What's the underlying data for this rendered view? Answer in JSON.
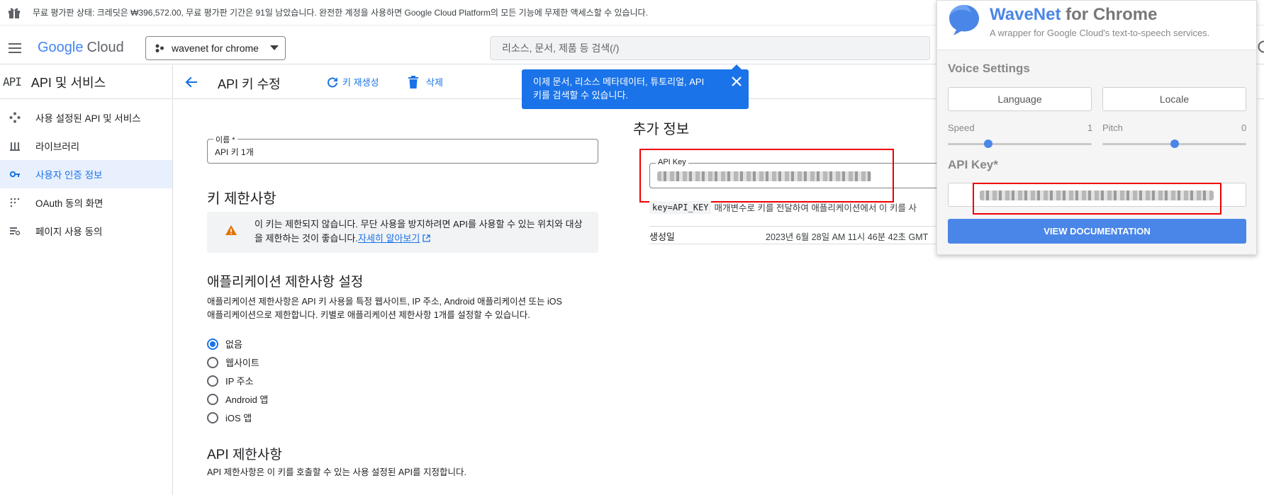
{
  "banner": {
    "text": "무료 평가판 상태: 크레딧은 ₩396,572.00, 무료 평가판 기간은 91일 남았습니다. 완전한 계정을 사용하면 Google Cloud Platform의 모든 기능에 무제한 액세스할 수 있습니다."
  },
  "topbar": {
    "logo_google": "Google",
    "logo_cloud": "Cloud",
    "project": "wavenet for chrome",
    "search_placeholder": "리소스, 문서, 제품 등 검색(/)"
  },
  "nav": {
    "api_badge": "API",
    "title": "API 및 서비스",
    "items": [
      {
        "label": "사용 설정된 API 및 서비스",
        "icon": "diamond-dots-icon"
      },
      {
        "label": "라이브러리",
        "icon": "library-icon"
      },
      {
        "label": "사용자 인증 정보",
        "icon": "key-icon"
      },
      {
        "label": "OAuth 동의 화면",
        "icon": "dots-grid-icon"
      },
      {
        "label": "페이지 사용 동의",
        "icon": "settings-list-icon"
      }
    ],
    "active_index": 2
  },
  "subbar": {
    "title": "API 키 수정",
    "regenerate": "키 재생성",
    "delete": "삭제"
  },
  "tooltip": {
    "text": "이제 문서, 리소스 메타데이터, 튜토리얼, API 키를 검색할 수 있습니다."
  },
  "form": {
    "name_label": "이름 *",
    "name_value": "API 키 1개",
    "key_restrictions_title": "키 제한사항",
    "warning_text": "이 키는 제한되지 않습니다. 무단 사용을 방지하려면 API를 사용할 수 있는 위치와 대상을 제한하는 것이 좋습니다.",
    "learn_more": "자세히 알아보기",
    "app_restrictions_title": "애플리케이션 제한사항 설정",
    "app_restrictions_desc_1": "애플리케이션 제한사항은 API 키 사용을 특정 웹사이트, IP 주소, Android 애플리케이션 또는 iOS",
    "app_restrictions_desc_2": "애플리케이션으로 제한합니다. 키별로 애플리케이션 제한사항 1개를 설정할 수 있습니다.",
    "radio_options": [
      "없음",
      "웹사이트",
      "IP 주소",
      "Android 앱",
      "iOS 앱"
    ],
    "selected_radio": 0,
    "api_restrictions_title": "API 제한사항",
    "api_restrictions_desc": "API 제한사항은 이 키를 호출할 수 있는 사용 설정된 API를 지정합니다."
  },
  "extra": {
    "title": "추가 정보",
    "api_key_label": "API Key",
    "param_code": "key=API_KEY",
    "param_desc": "매개변수로 키를 전달하여 애플리케이션에서 이 키를 사",
    "created_label": "생성일",
    "created_value": "2023년 6월 28일 AM 11시 46분 42초 GMT"
  },
  "extension": {
    "title_brand": "WaveNet",
    "title_rest": " for Chrome",
    "subtitle": "A wrapper for Google Cloud's text-to-speech services.",
    "voice_settings": "Voice Settings",
    "language_button": "Language",
    "locale_button": "Locale",
    "speed_label": "Speed",
    "speed_value": "1",
    "speed_level": 0.28,
    "pitch_label": "Pitch",
    "pitch_value": "0",
    "pitch_level": 0.5,
    "api_key_label": "API Key*",
    "view_docs": "VIEW DOCUMENTATION",
    "accent": "#4a86e8"
  }
}
